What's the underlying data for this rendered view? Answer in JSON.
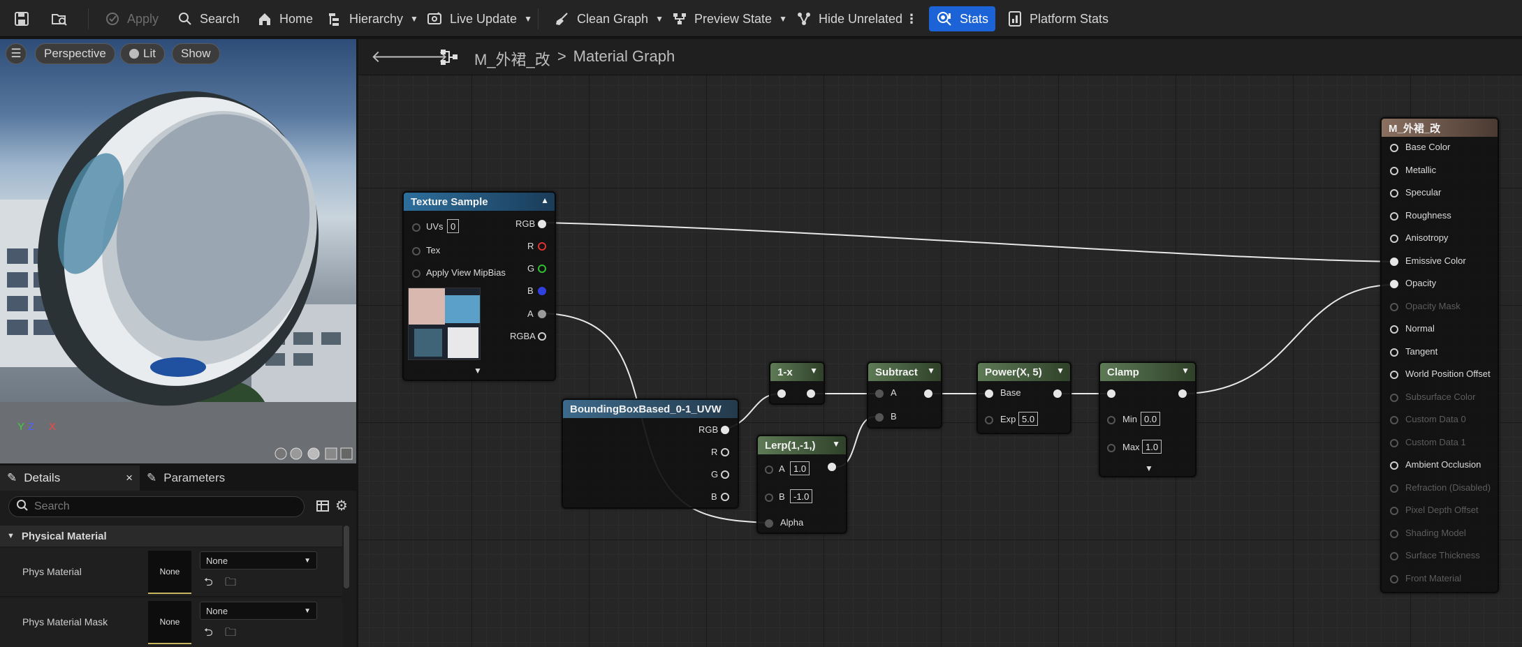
{
  "toolbar": {
    "apply": "Apply",
    "search": "Search",
    "home": "Home",
    "hierarchy": "Hierarchy",
    "live_update": "Live Update",
    "clean_graph": "Clean Graph",
    "preview_state": "Preview State",
    "hide_unrelated": "Hide Unrelated",
    "stats": "Stats",
    "platform_stats": "Platform Stats"
  },
  "viewport": {
    "perspective": "Perspective",
    "lit": "Lit",
    "show": "Show",
    "axis_z": "Z",
    "axis_x": "X",
    "axis_y": "Y"
  },
  "details_panel": {
    "tab_details": "Details",
    "tab_parameters": "Parameters",
    "search_placeholder": "Search",
    "section": "Physical Material",
    "rows": [
      {
        "label": "Phys Material",
        "thumb": "None",
        "select": "None"
      },
      {
        "label": "Phys Material Mask",
        "thumb": "None",
        "select": "None"
      }
    ]
  },
  "graph": {
    "breadcrumb_asset": "M_外裙_改",
    "breadcrumb_sep": ">",
    "breadcrumb_graph": "Material Graph"
  },
  "nodes": {
    "texture_sample": {
      "title": "Texture Sample",
      "uvs": "UVs",
      "uvs_value": "0",
      "tex": "Tex",
      "apply_mip": "Apply View MipBias",
      "rgb": "RGB",
      "r": "R",
      "g": "G",
      "b": "B",
      "a": "A",
      "rgba": "RGBA"
    },
    "bbox": {
      "title": "BoundingBoxBased_0-1_UVW",
      "rgb": "RGB",
      "r": "R",
      "g": "G",
      "b": "B"
    },
    "one_minus": {
      "title": "1-x"
    },
    "lerp": {
      "title": "Lerp(1,-1,)",
      "a": "A",
      "a_value": "1.0",
      "b": "B",
      "b_value": "-1.0",
      "alpha": "Alpha"
    },
    "subtract": {
      "title": "Subtract",
      "a": "A",
      "b": "B"
    },
    "power": {
      "title": "Power(X, 5)",
      "base": "Base",
      "exp": "Exp",
      "exp_value": "5.0"
    },
    "clamp": {
      "title": "Clamp",
      "min": "Min",
      "min_value": "0.0",
      "max": "Max",
      "max_value": "1.0"
    },
    "result": {
      "title": "M_外裙_改",
      "inputs": [
        {
          "label": "Base Color",
          "enabled": true
        },
        {
          "label": "Metallic",
          "enabled": true
        },
        {
          "label": "Specular",
          "enabled": true
        },
        {
          "label": "Roughness",
          "enabled": true
        },
        {
          "label": "Anisotropy",
          "enabled": true
        },
        {
          "label": "Emissive Color",
          "enabled": true
        },
        {
          "label": "Opacity",
          "enabled": true
        },
        {
          "label": "Opacity Mask",
          "enabled": false
        },
        {
          "label": "Normal",
          "enabled": true
        },
        {
          "label": "Tangent",
          "enabled": true
        },
        {
          "label": "World Position Offset",
          "enabled": true
        },
        {
          "label": "Subsurface Color",
          "enabled": false
        },
        {
          "label": "Custom Data 0",
          "enabled": false
        },
        {
          "label": "Custom Data 1",
          "enabled": false
        },
        {
          "label": "Ambient Occlusion",
          "enabled": true
        },
        {
          "label": "Refraction (Disabled)",
          "enabled": false
        },
        {
          "label": "Pixel Depth Offset",
          "enabled": false
        },
        {
          "label": "Shading Model",
          "enabled": false
        },
        {
          "label": "Surface Thickness",
          "enabled": false
        },
        {
          "label": "Front Material",
          "enabled": false
        }
      ]
    }
  },
  "colors": {
    "accent": "#1b63d6",
    "pin_r": "#e03030",
    "pin_g": "#30c030",
    "pin_b": "#3040e0"
  }
}
